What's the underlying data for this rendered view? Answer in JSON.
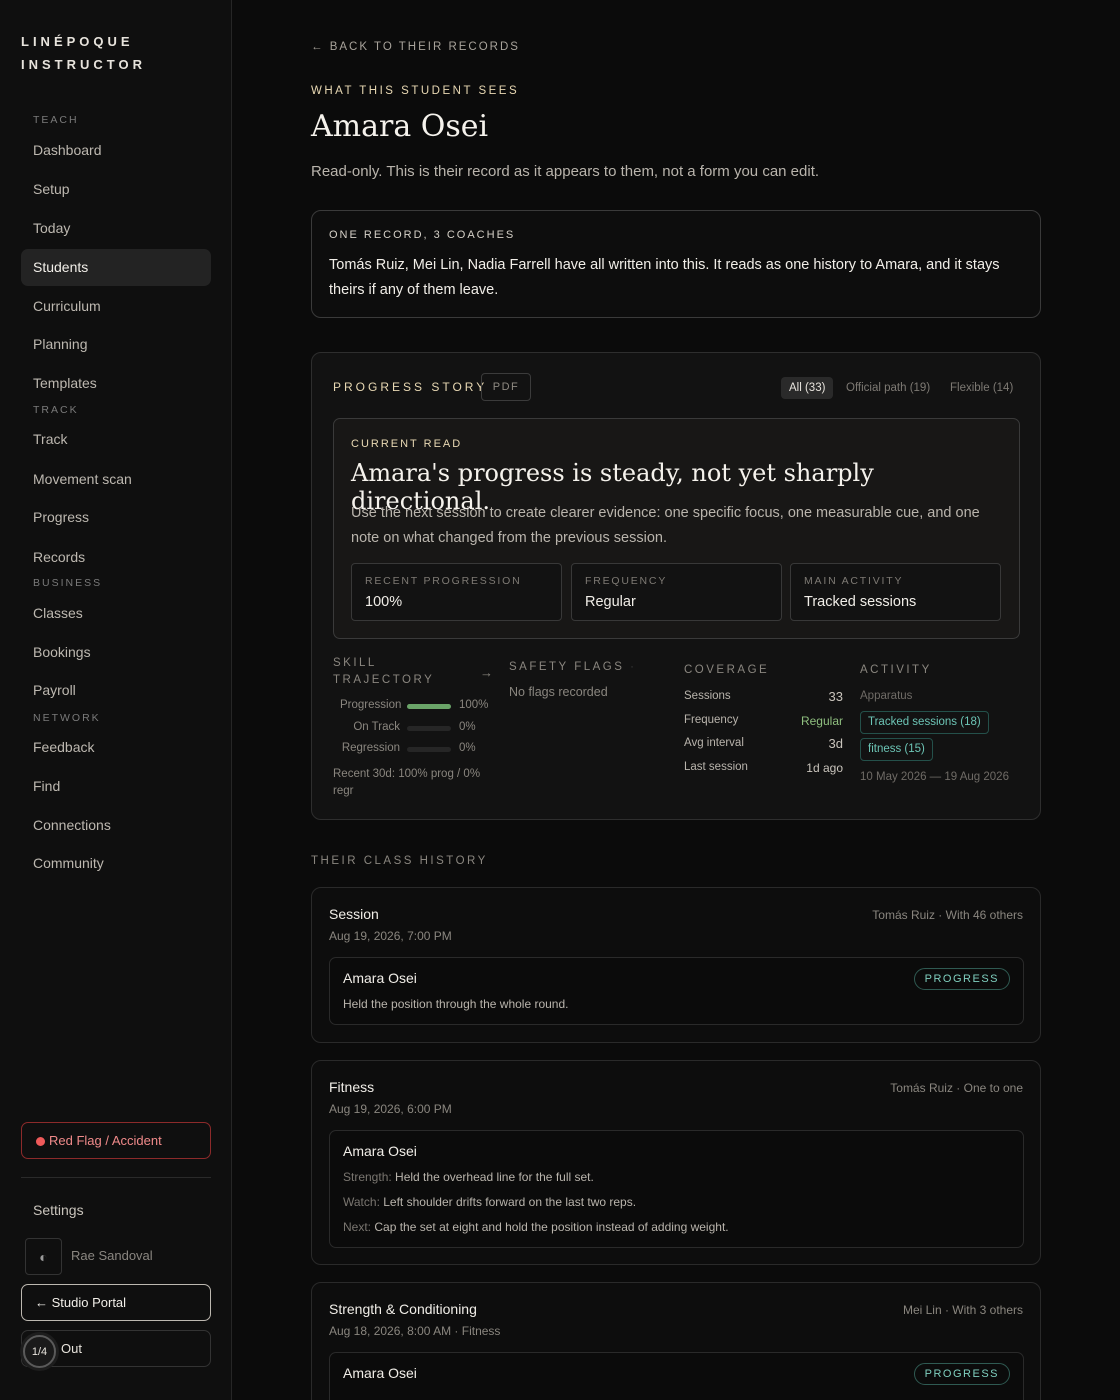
{
  "sidebar": {
    "brand_line1": "LINÉPOQUE",
    "brand_line2": "INSTRUCTOR",
    "sections": {
      "teach": "TEACH",
      "track": "TRACK",
      "business": "BUSINESS",
      "network": "NETWORK"
    },
    "items": [
      "Dashboard",
      "Setup",
      "Today",
      "Students",
      "Curriculum",
      "Planning",
      "Templates",
      "Track",
      "Movement scan",
      "Progress",
      "Records",
      "Classes",
      "Bookings",
      "Payroll",
      "Feedback",
      "Find",
      "Connections",
      "Community"
    ],
    "active_item": "Students",
    "red_flag": "Red Flag / Accident",
    "settings": "Settings",
    "user_name": "Rae Sandoval",
    "studio_portal": "← Studio Portal",
    "out": "Out",
    "pager": "1/4"
  },
  "header": {
    "back": "← BACK TO THEIR RECORDS",
    "eyebrow": "WHAT THIS STUDENT SEES",
    "title": "Amara Osei",
    "lead": "Read-only. This is their record as it appears to them, not a form you can edit."
  },
  "record_card": {
    "label": "ONE RECORD, 3 COACHES",
    "text": "Tomás Ruiz, Mei Lin, Nadia Farrell have all written into this. It reads as one history to Amara, and it stays theirs if any of them leave."
  },
  "progress_story": {
    "title": "PROGRESS STORY",
    "pdf": "PDF",
    "filters": [
      "All (33)",
      "Official path (19)",
      "Flexible (14)"
    ],
    "selected_filter": "All (33)",
    "current_read": {
      "label": "CURRENT READ",
      "headline": "Amara's progress is steady, not yet sharply directional.",
      "body": "Use the next session to create clearer evidence: one specific focus, one measurable cue, and one note on what changed from the previous session.",
      "stats": [
        {
          "label": "RECENT PROGRESSION",
          "value": "100%"
        },
        {
          "label": "FREQUENCY",
          "value": "Regular"
        },
        {
          "label": "MAIN ACTIVITY",
          "value": "Tracked sessions"
        }
      ]
    },
    "skill_trajectory": {
      "title_line1": "SKILL",
      "title_line2": "TRAJECTORY",
      "rows": [
        {
          "label": "Progression",
          "value": "100%",
          "fraction": 1.0
        },
        {
          "label": "On Track",
          "value": "0%",
          "fraction": 0
        },
        {
          "label": "Regression",
          "value": "0%",
          "fraction": 0
        }
      ],
      "recent_line1": "Recent 30d: 100% prog / 0%",
      "recent_line2": "regr"
    },
    "safety": {
      "title": "SAFETY FLAGS",
      "empty": "No flags recorded"
    },
    "coverage": {
      "title": "COVERAGE",
      "rows": [
        {
          "label": "Sessions",
          "value": "33"
        },
        {
          "label": "Frequency",
          "value": "Regular"
        },
        {
          "label": "Avg interval",
          "value": "3d"
        },
        {
          "label": "Last session",
          "value": "1d ago"
        }
      ],
      "frequency_color": "#8fbf7f"
    },
    "activity": {
      "title": "ACTIVITY",
      "sub": "Apparatus",
      "tags": [
        "Tracked sessions (18)",
        "fitness (15)"
      ],
      "range": "10 May 2026 — 19 Aug 2026"
    }
  },
  "history": {
    "title": "THEIR CLASS HISTORY",
    "entries": [
      {
        "title": "Session",
        "meta": "Tomás Ruiz · With 46 others",
        "date": "Aug 19, 2026, 7:00 PM",
        "student": "Amara Osei",
        "badge": "PROGRESS",
        "note": "Held the position through the whole round."
      },
      {
        "title": "Fitness",
        "meta": "Tomás Ruiz · One to one",
        "date": "Aug 19, 2026, 6:00 PM",
        "student": "Amara Osei",
        "strength_label": "Strength:",
        "strength": "Held the overhead line for the full set.",
        "watch_label": "Watch:",
        "watch": "Left shoulder drifts forward on the last two reps.",
        "next_label": "Next:",
        "next": "Cap the set at eight and hold the position instead of adding weight."
      },
      {
        "title": "Strength & Conditioning",
        "meta": "Mei Lin · With 3 others",
        "date": "Aug 18, 2026, 8:00 AM · Fitness",
        "student": "Amara Osei",
        "badge": "PROGRESS"
      }
    ]
  }
}
